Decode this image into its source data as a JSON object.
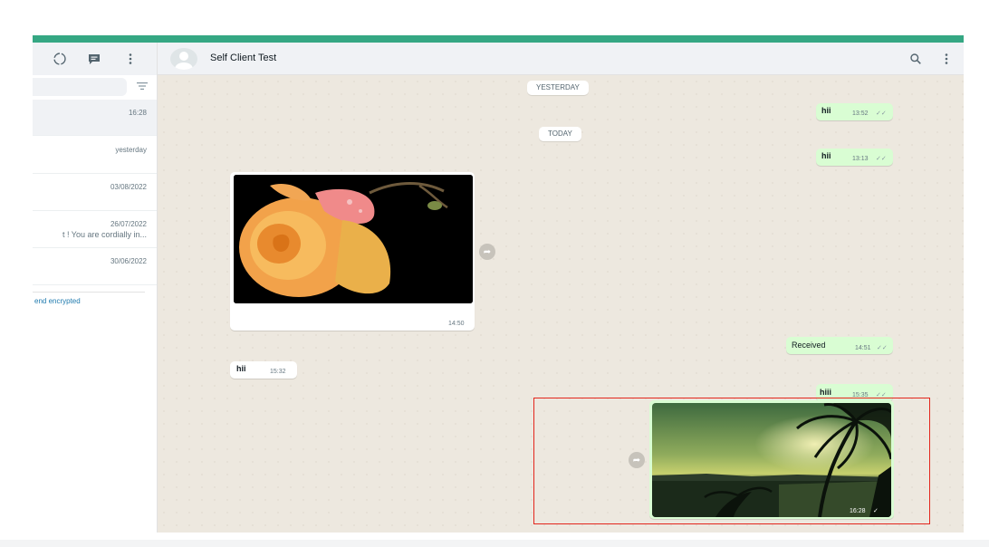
{
  "sidebar": {
    "header_icons": [
      "status-icon",
      "new-chat-icon",
      "menu-icon"
    ],
    "search": {
      "placeholder": ""
    },
    "chats": [
      {
        "time": "16:28",
        "preview": ""
      },
      {
        "time": "yesterday",
        "preview": ""
      },
      {
        "time": "03/08/2022",
        "preview": ""
      },
      {
        "time": "26/07/2022",
        "preview": "t ! You are cordially in..."
      },
      {
        "time": "30/06/2022",
        "preview": ""
      }
    ],
    "encryption_note": "end encrypted"
  },
  "chat": {
    "contact_name": "Self Client Test",
    "header_icons": [
      "search-icon",
      "menu-icon"
    ],
    "dates": {
      "yesterday": "YESTERDAY",
      "today": "TODAY"
    },
    "messages": [
      {
        "direction": "out",
        "text": "hii",
        "time": "13:52",
        "status": "read"
      },
      {
        "direction": "out",
        "text": "hii",
        "time": "13:13",
        "status": "read"
      },
      {
        "direction": "in",
        "type": "image",
        "image": "orange rose",
        "time": "14:50"
      },
      {
        "direction": "out",
        "text": "Received",
        "time": "14:51",
        "status": "read"
      },
      {
        "direction": "in",
        "text": "hii",
        "time": "15:32"
      },
      {
        "direction": "out",
        "text": "hiii",
        "time": "15:35",
        "status": "read"
      },
      {
        "direction": "out",
        "type": "image",
        "image": "tropical sunset with palm trees",
        "time": "16:28",
        "status": "sent"
      }
    ]
  },
  "colors": {
    "accent_bar": "#35a783",
    "outgoing_bubble": "#d9fdd3",
    "incoming_bubble": "#ffffff",
    "highlight_border": "#e3261c",
    "link": "#1f7aae"
  }
}
